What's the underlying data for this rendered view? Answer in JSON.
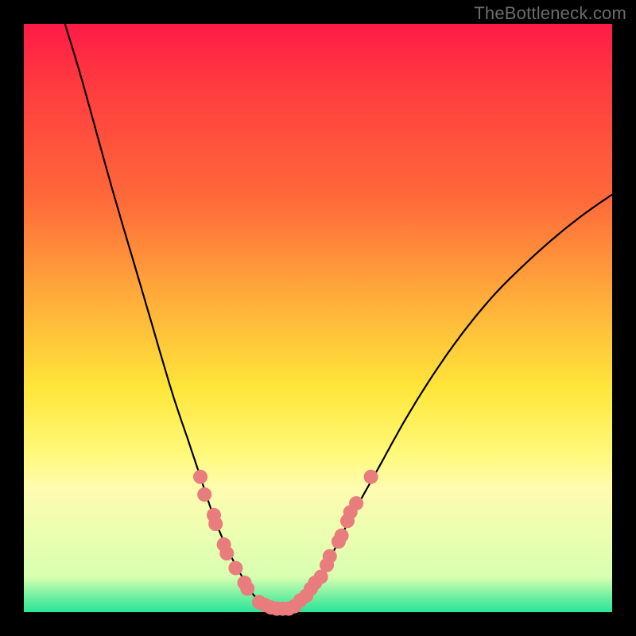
{
  "watermark": "TheBottleneck.com",
  "colors": {
    "curve": "#000000",
    "marker_fill": "#e97c7c",
    "marker_stroke": "#c85a5a",
    "background_top": "#ff1a47",
    "background_bottom": "#2ae498",
    "frame": "#000000"
  },
  "chart_data": {
    "type": "line",
    "title": "",
    "xlabel": "",
    "ylabel": "",
    "xlim": [
      0,
      100
    ],
    "ylim": [
      0,
      100
    ],
    "grid": false,
    "legend": false,
    "series": [
      {
        "name": "bottleneck-curve-left",
        "x": [
          7,
          10,
          15,
          20,
          25,
          28,
          30,
          32,
          34,
          36,
          38,
          39,
          40,
          41,
          42
        ],
        "y": [
          100,
          90,
          72,
          55,
          38,
          29,
          23,
          17,
          12,
          8,
          4.5,
          3,
          2,
          1.2,
          0.6
        ]
      },
      {
        "name": "bottleneck-curve-right",
        "x": [
          42,
          44,
          46,
          48,
          50,
          52,
          55,
          60,
          65,
          70,
          75,
          80,
          85,
          90,
          95,
          100
        ],
        "y": [
          0.6,
          0.6,
          1.0,
          2.5,
          5,
          9,
          15,
          24,
          33,
          41,
          48,
          54,
          59,
          63.5,
          67.5,
          71
        ]
      }
    ],
    "markers": {
      "name": "highlighted-points",
      "points": [
        {
          "x": 30.0,
          "y": 23.0
        },
        {
          "x": 30.7,
          "y": 20.0
        },
        {
          "x": 32.3,
          "y": 16.5
        },
        {
          "x": 32.6,
          "y": 15.0
        },
        {
          "x": 34.0,
          "y": 11.5
        },
        {
          "x": 34.5,
          "y": 10.0
        },
        {
          "x": 36.0,
          "y": 7.5
        },
        {
          "x": 37.5,
          "y": 5.0
        },
        {
          "x": 38.0,
          "y": 4.0
        },
        {
          "x": 40.0,
          "y": 1.7
        },
        {
          "x": 41.0,
          "y": 1.2
        },
        {
          "x": 42.0,
          "y": 0.8
        },
        {
          "x": 43.0,
          "y": 0.6
        },
        {
          "x": 44.0,
          "y": 0.6
        },
        {
          "x": 45.0,
          "y": 0.6
        },
        {
          "x": 46.0,
          "y": 1.0
        },
        {
          "x": 47.0,
          "y": 2.0
        },
        {
          "x": 48.0,
          "y": 2.8
        },
        {
          "x": 48.8,
          "y": 4.0
        },
        {
          "x": 49.5,
          "y": 5.0
        },
        {
          "x": 50.5,
          "y": 6.0
        },
        {
          "x": 51.5,
          "y": 8.0
        },
        {
          "x": 52.0,
          "y": 9.5
        },
        {
          "x": 53.5,
          "y": 12.0
        },
        {
          "x": 54.0,
          "y": 13.0
        },
        {
          "x": 55.0,
          "y": 15.5
        },
        {
          "x": 55.5,
          "y": 17.0
        },
        {
          "x": 56.5,
          "y": 18.5
        },
        {
          "x": 59.0,
          "y": 23.0
        }
      ]
    }
  }
}
